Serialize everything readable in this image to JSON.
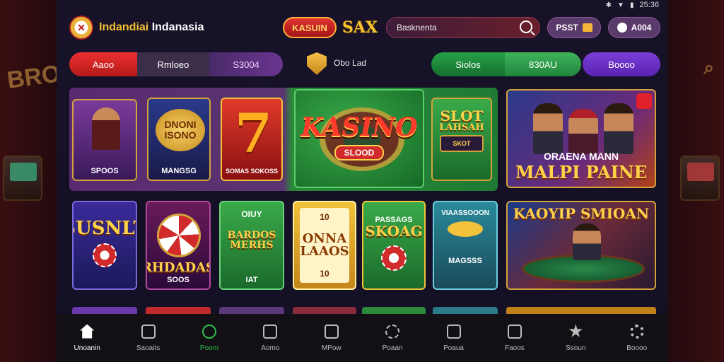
{
  "status_bar": {
    "time": "25:36"
  },
  "header": {
    "brand_part1": "Indandiai",
    "brand_part2": "Indanasia",
    "kasino_pill": "KASUIN",
    "sax_label": "SAX",
    "search_placeholder": "Basknenta",
    "btn_psst": "PSST",
    "btn_adoo": "A004"
  },
  "segments": {
    "seg1": "Aaoo",
    "seg2": "Rmloeo",
    "seg3": "S3004",
    "middle_label": "Obo Lad",
    "seg4": "Siolos",
    "seg5": "830AU",
    "seg6": "Boooo"
  },
  "cards_row1": {
    "c1_label": "SPOOS",
    "c2_emblem": "DNONI ISONO",
    "c2_label": "MANGSG",
    "c3_label": "SOMAS SOKOSS",
    "c4_title": "KASINO",
    "c4_sub": "SLOOD",
    "c5_title": "SLOT",
    "c5_sub": "LAHSAH",
    "c5_mini": "SKOT",
    "c6_headline": "ORAENA MANN",
    "c6_big": "MALPI PAINE"
  },
  "cards_row2": {
    "d1_title": "SUSNLT",
    "d2_label": "RHDADAS",
    "d2_sub": "SOOS",
    "d3_top": "OIUY",
    "d3_title": "BARDOS MERHS",
    "d3_label": "IAT",
    "d4_top": "10",
    "d4_title": "ONNA LAAOS",
    "d4_bottom": "10",
    "d5_label": "PASSAGS",
    "d5_title": "SKOAG",
    "d6_top": "VIAASSOOON",
    "d6_bottom": "MAGSSS",
    "d7_title": "KAOYIP SMIOAN"
  },
  "nav": [
    {
      "label": "Unoanin",
      "icon": "home-icon"
    },
    {
      "label": "Saoaits",
      "icon": "hammer-icon"
    },
    {
      "label": "Poom",
      "icon": "power-icon"
    },
    {
      "label": "Aomo",
      "icon": "monitor-icon"
    },
    {
      "label": "MPow",
      "icon": "tablet-icon"
    },
    {
      "label": "Poaan",
      "icon": "chip-icon"
    },
    {
      "label": "Poaua",
      "icon": "machine-icon"
    },
    {
      "label": "Faoos",
      "icon": "leaf-icon"
    },
    {
      "label": "Ssoun",
      "icon": "star-icon"
    },
    {
      "label": "Boooo",
      "icon": "gear-icon"
    }
  ]
}
